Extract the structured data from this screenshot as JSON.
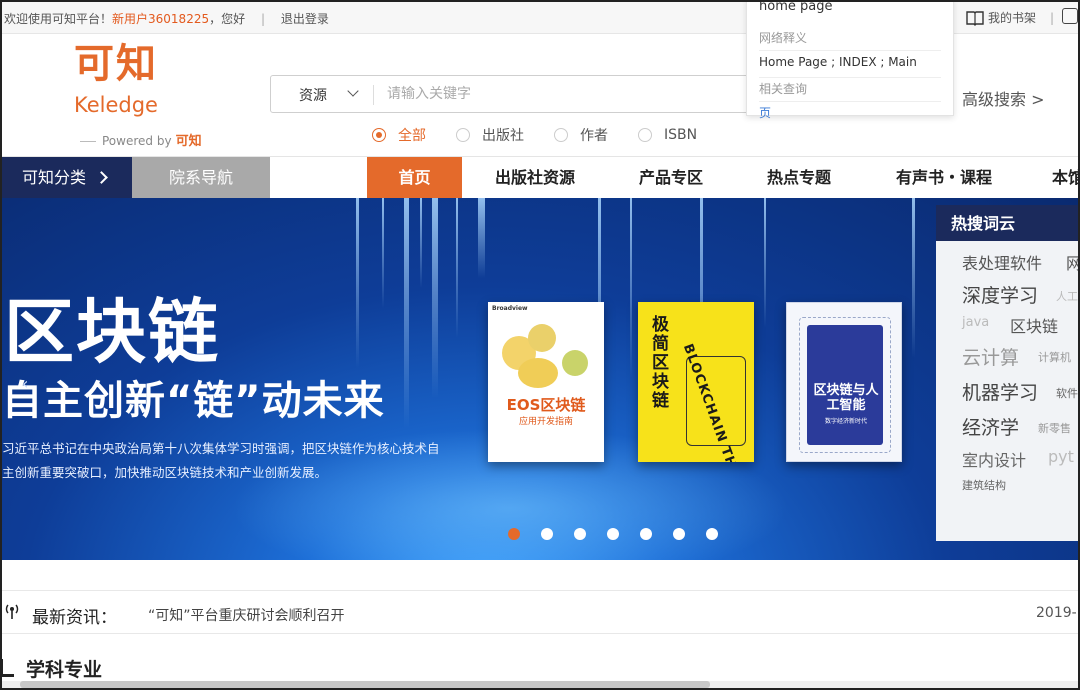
{
  "topbar": {
    "welcome": "欢迎使用可知平台！",
    "new_user": "新用户36018225",
    "greeting": "，您好",
    "separator": "|",
    "logout": "退出登录",
    "bookshelf": "我的书架",
    "bookshelf_separator": "|"
  },
  "logo": {
    "cn": "可知",
    "en": "Keledge",
    "powered": "Powered by",
    "powered_brand": "可知"
  },
  "search": {
    "category": "资源",
    "placeholder": "请输入关键字",
    "advanced": "高级搜索 >",
    "options": [
      {
        "label": "全部",
        "selected": true
      },
      {
        "label": "出版社",
        "selected": false
      },
      {
        "label": "作者",
        "selected": false
      },
      {
        "label": "ISBN",
        "selected": false
      }
    ]
  },
  "dictionary": {
    "word": "home page",
    "meaning_header": "网络释义",
    "meaning": "Home Page ; INDEX ; Main",
    "related_header": "相关查询",
    "related": "页"
  },
  "nav": {
    "classify": "可知分类",
    "department": "院系导航",
    "items": [
      {
        "label": "首页",
        "active": true
      },
      {
        "label": "出版社资源",
        "active": false
      },
      {
        "label": "产品专区",
        "active": false
      },
      {
        "label": "热点专题",
        "active": false
      },
      {
        "label": "有声书・课程",
        "active": false
      },
      {
        "label": "本馆",
        "active": false
      }
    ]
  },
  "banner": {
    "title": "区块链",
    "subtitle": "自主创新“链”动未来",
    "para1": "习近平总书记在中央政治局第十八次集体学习时强调，把区块链作为核心技术自",
    "para2": "主创新重要突破口，加快推动区块链技术和产业创新发展。",
    "prev": "‹",
    "books": [
      {
        "title": "EOS区块链",
        "subtitle": "应用开发指南",
        "brand": "Broadview"
      },
      {
        "title": "极简区块链",
        "subtitle": "BLOCKCHAIN THE UNTOLD STORY"
      },
      {
        "title": "区块链与人工智能",
        "subtitle": "数字经济新时代"
      }
    ],
    "slide_count": 7,
    "active_slide": 1,
    "colors": {
      "accent": "#e46a2b",
      "navy": "#1b2a5c"
    }
  },
  "hot_words": {
    "title": "热搜词云",
    "words": [
      "表处理软件",
      "网",
      "深度学习",
      "人工",
      "java",
      "区块链",
      "云计算",
      "计算机",
      "机器学习",
      "软件",
      "经济学",
      "新零售",
      "室内设计",
      "pyt",
      "建筑结构"
    ]
  },
  "news": {
    "label": "最新资讯：",
    "text": "“可知”平台重庆研讨会顺利召开",
    "date": "2019-"
  },
  "subject": {
    "title": "学科专业"
  }
}
